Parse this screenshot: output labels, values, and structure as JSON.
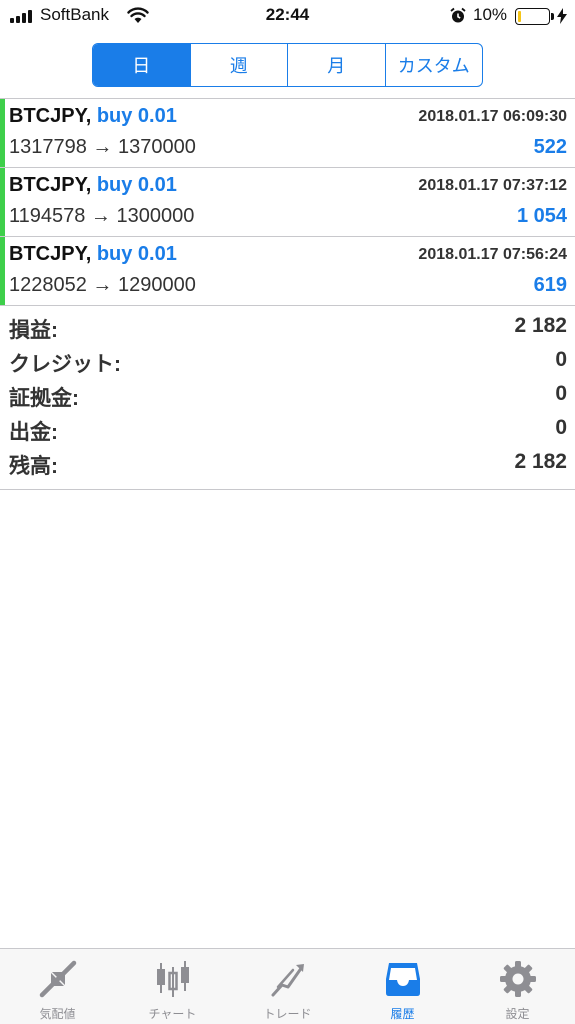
{
  "status_bar": {
    "carrier": "SoftBank",
    "time": "22:44",
    "battery_percent": "10%",
    "battery_level": 0.1,
    "battery_color": "#f5c518"
  },
  "period_tabs": [
    {
      "label": "日",
      "active": true
    },
    {
      "label": "週",
      "active": false
    },
    {
      "label": "月",
      "active": false
    },
    {
      "label": "カスタム",
      "active": false
    }
  ],
  "trades": [
    {
      "symbol": "BTCJPY,",
      "side": "buy 0.01",
      "datetime": "2018.01.17 06:09:30",
      "prices": "1317798 → 1370000",
      "profit": "522"
    },
    {
      "symbol": "BTCJPY,",
      "side": "buy 0.01",
      "datetime": "2018.01.17 07:37:12",
      "prices": "1194578 → 1300000",
      "profit": "1 054"
    },
    {
      "symbol": "BTCJPY,",
      "side": "buy 0.01",
      "datetime": "2018.01.17 07:56:24",
      "prices": "1228052 → 1290000",
      "profit": "619"
    }
  ],
  "summary": [
    {
      "label": "損益:",
      "value": "2 182"
    },
    {
      "label": "クレジット:",
      "value": "0"
    },
    {
      "label": "証拠金:",
      "value": "0"
    },
    {
      "label": "出金:",
      "value": "0"
    },
    {
      "label": "残高:",
      "value": "2 182"
    }
  ],
  "tab_bar": [
    {
      "label": "気配値",
      "icon": "quotes-icon",
      "active": false
    },
    {
      "label": "チャート",
      "icon": "chart-icon",
      "active": false
    },
    {
      "label": "トレード",
      "icon": "trade-icon",
      "active": false
    },
    {
      "label": "履歴",
      "icon": "history-icon",
      "active": true
    },
    {
      "label": "設定",
      "icon": "settings-icon",
      "active": false
    }
  ],
  "colors": {
    "accent": "#1a7de8",
    "buy_bar": "#3ecf4a",
    "inactive_tab": "#8e8e93"
  }
}
